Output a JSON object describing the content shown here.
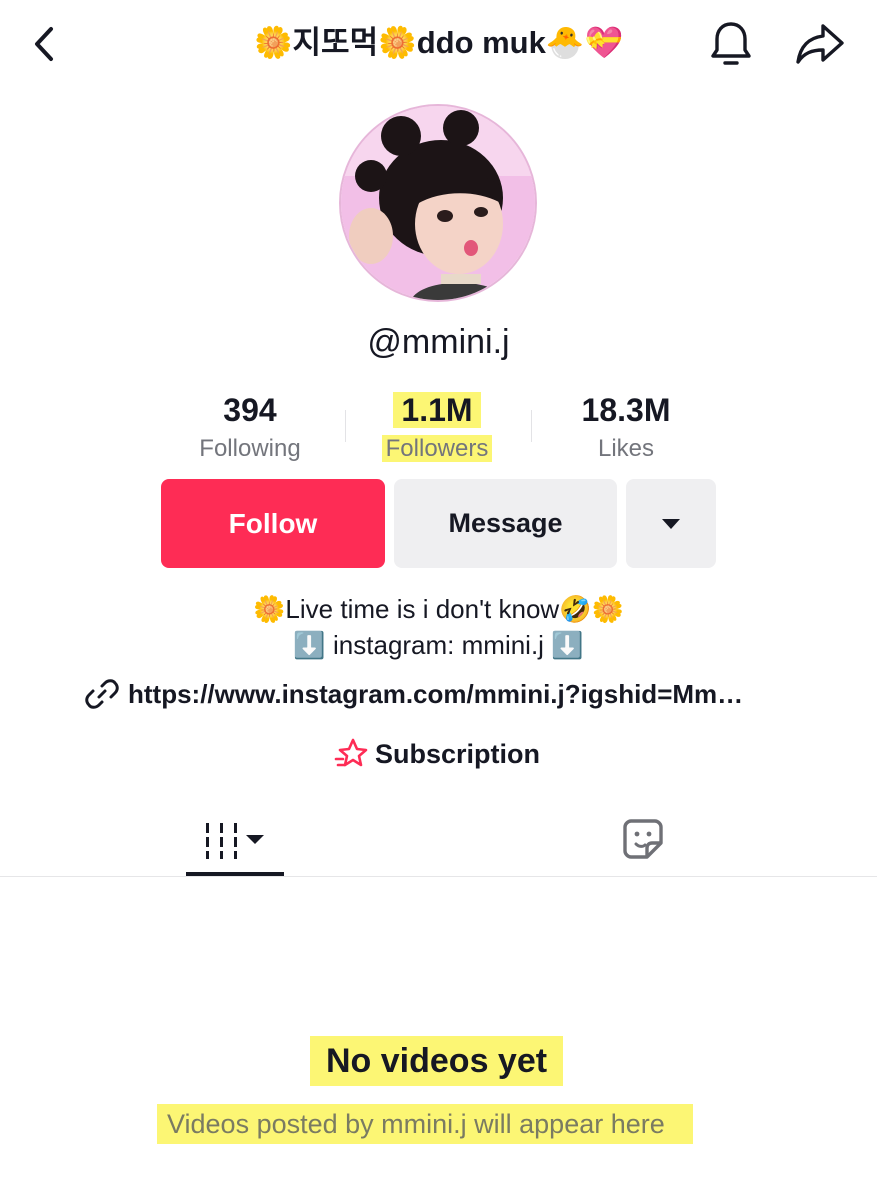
{
  "header": {
    "title": "🌼지또먹🌼ddo muk🐣💝"
  },
  "profile": {
    "username": "@mmini.j"
  },
  "stats": [
    {
      "value": "394",
      "label": "Following"
    },
    {
      "value": "1.1M",
      "label": "Followers"
    },
    {
      "value": "18.3M",
      "label": "Likes"
    }
  ],
  "actions": {
    "follow_label": "Follow",
    "message_label": "Message"
  },
  "bio": {
    "line1": "🌼Live time is i don't know🤣🌼",
    "line2": "⬇️ instagram: mmini.j ⬇️",
    "link": "https://www.instagram.com/mmini.j?igshid=Mm…",
    "subscription_label": "Subscription"
  },
  "empty_state": {
    "title": "No videos yet",
    "subtitle": "Videos posted by mmini.j will appear here"
  },
  "colors": {
    "accent": "#fe2c55",
    "highlight": "#fcf55c",
    "button_gray": "#efeff1",
    "text": "#161823"
  },
  "icons": {
    "back": "chevron-left-icon",
    "notifications": "bell-icon",
    "share": "share-arrow-icon",
    "more": "caret-down-icon",
    "link": "link-icon",
    "subscription": "subscription-star-icon",
    "videos_tab": "grid-bars-icon",
    "reposts_tab": "sticker-icon"
  }
}
